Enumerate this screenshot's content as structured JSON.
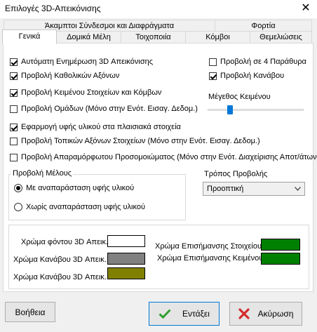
{
  "window": {
    "title": "Επιλογές 3D-Απεικόνισης",
    "close_glyph": "✕"
  },
  "tabs": {
    "row1": [
      "Άκαμπτοι Σύνδεσμοι και Διαφράγματα",
      "Φορτία"
    ],
    "row2": [
      "Γενικά",
      "Δομικά Μέλη",
      "Τοιχοποιία",
      "Κόμβοι",
      "Θεμελιώσεις"
    ],
    "active": "Γενικά"
  },
  "options": {
    "auto_update": {
      "label": "Αυτόματη Ενημέρωση 3D Απεικόνισης",
      "checked": true
    },
    "global_axes": {
      "label": "Προβολή Καθολικών Αξόνων",
      "checked": true
    },
    "element_text": {
      "label": "Προβολή Κειμένου Στοιχείων και Κόμβων",
      "checked": true
    },
    "groups": {
      "label": "Προβολή Ομάδων (Μόνο στην Ενότ. Εισαγ. Δεδομ.)",
      "checked": false
    },
    "texture_frames": {
      "label": "Εφαρμογή υφής υλικού στα πλαισιακά στοιχεία",
      "checked": true
    },
    "local_axes": {
      "label": "Προβολή Τοπικών Αξόνων Στοιχείων (Μόνο στην Ενότ. Εισαγ. Δεδομ.)",
      "checked": false
    },
    "undeformed": {
      "label": "Προβολή Απαραμόρφωτου Προσομοιώματος (Μόνο στην Ενότ. Διαχείρισης Αποτ/άτων)",
      "checked": false
    },
    "four_windows": {
      "label": "Προβολή σε 4 Παράθυρα",
      "checked": false
    },
    "grid": {
      "label": "Προβολή Κανάβου",
      "checked": true
    }
  },
  "text_size": {
    "label": "Μέγεθος Κειμένου",
    "value": 0.22
  },
  "member_view": {
    "label": "Προβολή Μέλους",
    "options": [
      "Με αναπαράσταση υφής υλικού",
      "Χωρίς αναπαράσταση υφής υλικού"
    ],
    "selected": 0
  },
  "view_mode": {
    "label": "Τρόπος Προβολής",
    "value": "Προοπτική"
  },
  "colors": {
    "background": {
      "label": "Χρώμα φόντου 3D Απεικ.",
      "color": "#ffffff"
    },
    "grid1": {
      "label": "Χρώμα Κανάβου 3D Απεικ.",
      "color": "#808080"
    },
    "grid2": {
      "label": "Χρώμα Κανάβου 3D Απεικ.",
      "color": "#808000"
    },
    "highlight_element": {
      "label": "Χρώμα Επισήμανσης Στοιχείου",
      "color": "#008000"
    },
    "highlight_text": {
      "label": "Χρώμα Επισήμανσης Κειμένου",
      "color": "#008000"
    }
  },
  "buttons": {
    "help": "Βοήθεια",
    "ok": "Εντάξει",
    "cancel": "Ακύρωση"
  },
  "icons": {
    "ok": "check-icon",
    "cancel": "x-icon"
  }
}
